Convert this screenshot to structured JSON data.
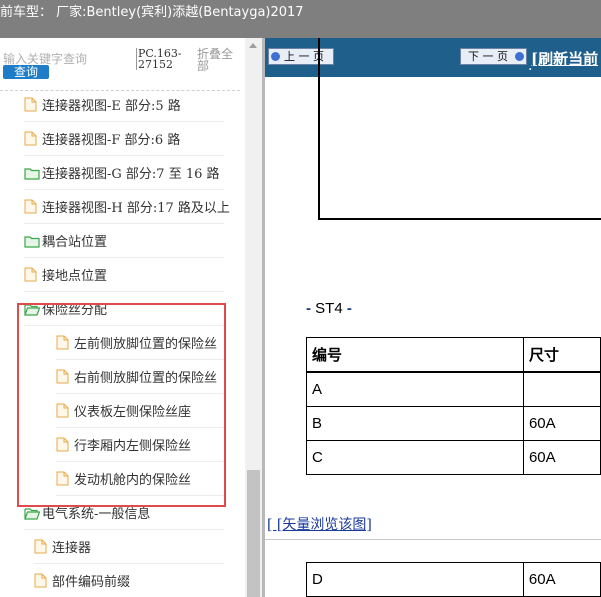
{
  "header": {
    "title": "前车型：  厂家:Bentley(宾利)添越(Bentayga)2017"
  },
  "search": {
    "placeholder": "输入关键字查询",
    "button": "查询"
  },
  "doc_code": "PC.163-27152",
  "collapse_all": "折叠全部",
  "tree": [
    {
      "label": "连接器视图-E 部分:5 路",
      "icon": "file-icon"
    },
    {
      "label": "连接器视图-F 部分:6 路",
      "icon": "file-icon"
    },
    {
      "label": "连接器视图-G 部分:7 至 16 路",
      "icon": "folder-icon"
    },
    {
      "label": "连接器视图-H 部分:17 路及以上",
      "icon": "file-icon"
    },
    {
      "label": "耦合站位置",
      "icon": "folder-icon"
    },
    {
      "label": "接地点位置",
      "icon": "file-icon"
    },
    {
      "label": "保险丝分配",
      "icon": "folder-open-icon"
    },
    {
      "label": "左前侧放脚位置的保险丝",
      "icon": "file-icon"
    },
    {
      "label": "右前侧放脚位置的保险丝",
      "icon": "file-icon"
    },
    {
      "label": "仪表板左侧保险丝座",
      "icon": "file-icon"
    },
    {
      "label": "行李厢内左侧保险丝",
      "icon": "file-icon"
    },
    {
      "label": "发动机舱内的保险丝",
      "icon": "file-icon"
    },
    {
      "label": "电气系统-一般信息",
      "icon": "folder-open-icon"
    },
    {
      "label": "连接器",
      "icon": "file-icon"
    },
    {
      "label": "部件编码前缀",
      "icon": "file-icon"
    }
  ],
  "nav": {
    "prev": "上 一 页",
    "next": "下 一 页",
    "dot": ".",
    "refresh": "[刷新当前"
  },
  "document": {
    "section_label": "ST4",
    "section_dash": "-",
    "table_headers": [
      "编号",
      "尺寸"
    ],
    "rows": [
      [
        "A",
        ""
      ],
      [
        "B",
        "60A"
      ],
      [
        "C",
        "60A"
      ]
    ],
    "vector_link": "[ [矢量浏览该图]",
    "rows2": [
      [
        "D",
        "60A"
      ]
    ]
  },
  "colors": {
    "nav_bar": "#1f5f8c",
    "highlight": "#e04a4a",
    "search_button": "#1f7dc8",
    "folder": "#3aa64a",
    "file": "#e8a94a"
  }
}
